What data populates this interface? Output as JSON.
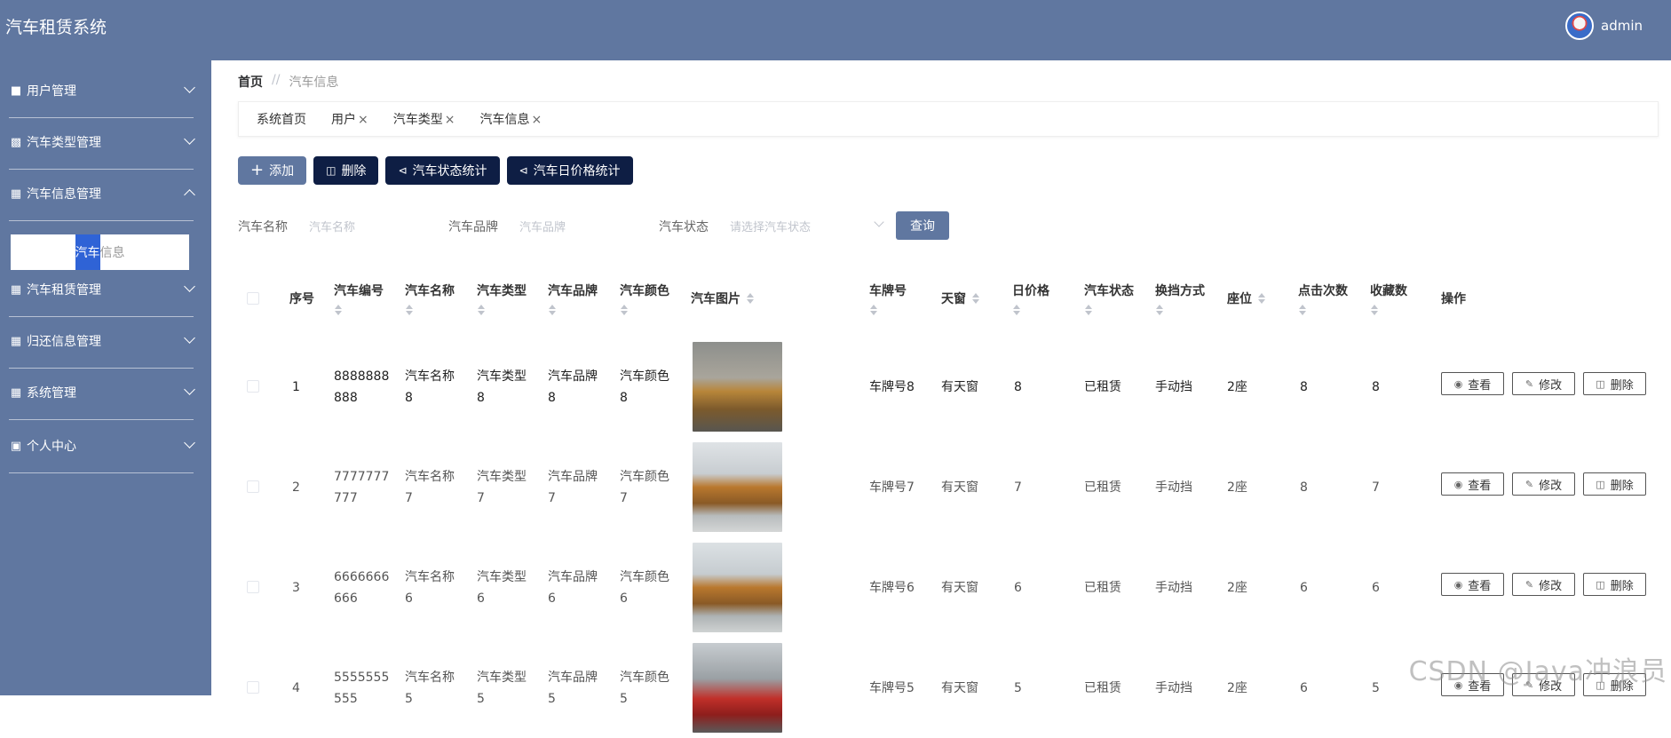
{
  "app": {
    "title": "汽车租赁系统",
    "user": "admin"
  },
  "sidebar": {
    "items": [
      {
        "label": "用户管理",
        "icon": "user-group-icon"
      },
      {
        "label": "汽车类型管理",
        "icon": "bar-chart-icon"
      },
      {
        "label": "汽车信息管理",
        "icon": "grid-icon",
        "expanded": true
      },
      {
        "label": "汽车租赁管理",
        "icon": "grid-icon"
      },
      {
        "label": "归还信息管理",
        "icon": "grid-icon"
      },
      {
        "label": "系统管理",
        "icon": "grid-icon"
      },
      {
        "label": "个人中心",
        "icon": "card-icon"
      }
    ],
    "submenu": {
      "label_hl": "汽车",
      "label_rest": "信息"
    }
  },
  "breadcrumb": {
    "home": "首页",
    "sep": "//",
    "current": "汽车信息"
  },
  "tabs": [
    {
      "label": "系统首页",
      "closable": false
    },
    {
      "label": "用户",
      "closable": true
    },
    {
      "label": "汽车类型",
      "closable": true
    },
    {
      "label": "汽车信息",
      "closable": true
    }
  ],
  "close_glyph": "×",
  "actions": {
    "add": "添加",
    "delete": "删除",
    "status_stats": "汽车状态统计",
    "price_stats": "汽车日价格统计"
  },
  "filters": {
    "name_label": "汽车名称",
    "name_placeholder": "汽车名称",
    "brand_label": "汽车品牌",
    "brand_placeholder": "汽车品牌",
    "status_label": "汽车状态",
    "status_placeholder": "请选择汽车状态",
    "query": "查询"
  },
  "table": {
    "headers": {
      "index": "序号",
      "code": "汽车编号",
      "name": "汽车名称",
      "type": "汽车类型",
      "brand": "汽车品牌",
      "color": "汽车颜色",
      "image": "汽车图片",
      "plate": "车牌号",
      "sunroof": "天窗",
      "price": "日价格",
      "status": "汽车状态",
      "gear": "换挡方式",
      "seat": "座位",
      "clicks": "点击次数",
      "favs": "收藏数",
      "ops": "操作"
    },
    "ops": {
      "view": "查看",
      "edit": "修改",
      "remove": "删除"
    },
    "rows": [
      {
        "index": "1",
        "code_a": "8888888",
        "code_b": "888",
        "name_a": "汽车名称",
        "name_b": "8",
        "type_a": "汽车类型",
        "type_b": "8",
        "brand_a": "汽车品牌",
        "brand_b": "8",
        "color_a": "汽车颜色",
        "color_b": "8",
        "plate": "车牌号8",
        "sunroof": "有天窗",
        "price": "8",
        "status": "已租赁",
        "gear": "手动挡",
        "seat": "2座",
        "clicks": "8",
        "favs": "8",
        "car_color": "#b8863a"
      },
      {
        "index": "2",
        "code_a": "7777777",
        "code_b": "777",
        "name_a": "汽车名称",
        "name_b": "7",
        "type_a": "汽车类型",
        "type_b": "7",
        "brand_a": "汽车品牌",
        "brand_b": "7",
        "color_a": "汽车颜色",
        "color_b": "7",
        "plate": "车牌号7",
        "sunroof": "有天窗",
        "price": "7",
        "status": "已租赁",
        "gear": "手动挡",
        "seat": "2座",
        "clicks": "8",
        "favs": "7",
        "car_color": "#b9782e"
      },
      {
        "index": "3",
        "code_a": "6666666",
        "code_b": "666",
        "name_a": "汽车名称",
        "name_b": "6",
        "type_a": "汽车类型",
        "type_b": "6",
        "brand_a": "汽车品牌",
        "brand_b": "6",
        "color_a": "汽车颜色",
        "color_b": "6",
        "plate": "车牌号6",
        "sunroof": "有天窗",
        "price": "6",
        "status": "已租赁",
        "gear": "手动挡",
        "seat": "2座",
        "clicks": "6",
        "favs": "6",
        "car_color": "#b9782e"
      },
      {
        "index": "4",
        "code_a": "5555555",
        "code_b": "555",
        "name_a": "汽车名称",
        "name_b": "5",
        "type_a": "汽车类型",
        "type_b": "5",
        "brand_a": "汽车品牌",
        "brand_b": "5",
        "color_a": "汽车颜色",
        "color_b": "5",
        "plate": "车牌号5",
        "sunroof": "有天窗",
        "price": "5",
        "status": "已租赁",
        "gear": "手动挡",
        "seat": "2座",
        "clicks": "6",
        "favs": "5",
        "car_color": "#c0302a"
      }
    ]
  },
  "watermark": "CSDN @Java冲浪员",
  "colors": {
    "sidebar": "#6077a0",
    "dark_button": "#0e1e44",
    "highlight": "#2f63d6"
  }
}
